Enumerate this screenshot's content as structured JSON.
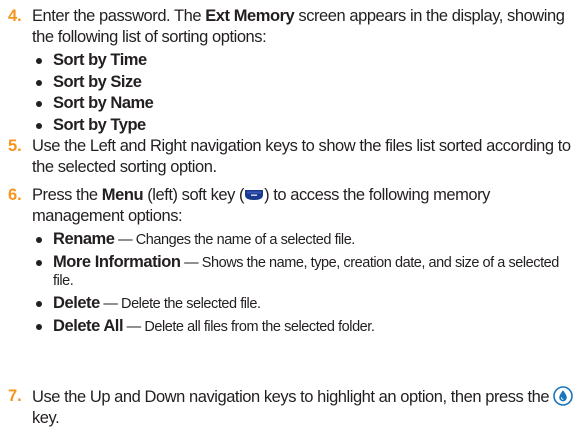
{
  "colors": {
    "step_number": "#f7941d",
    "text": "#231f20",
    "icon_blue": "#1b75bb",
    "softkey_fill": "#1a3a8f"
  },
  "step4": {
    "number": "4.",
    "text_before": "Enter the password. The ",
    "screen_name": "Ext Memory",
    "text_after": " screen appears in the display, showing the following list of sorting options:",
    "options": [
      "Sort by Time",
      "Sort by Size",
      "Sort by Name",
      "Sort by Type"
    ]
  },
  "step5": {
    "number": "5.",
    "text": "Use the Left and Right navigation keys to show the files list sorted according to the selected sorting option."
  },
  "step6": {
    "number": "6.",
    "text_before": "Press the ",
    "menu_label": "Menu",
    "text_middle": " (left) soft key (",
    "softkey_icon": "left-softkey-icon",
    "text_after": ") to access the following memory management options:",
    "options": [
      {
        "term": "Rename",
        "desc": "Changes the name of a selected file."
      },
      {
        "term": "More Information",
        "desc": "Shows the name, type, creation date, and size of a selected file."
      },
      {
        "term": "Delete",
        "desc": "Delete the selected file."
      },
      {
        "term": "Delete All",
        "desc": "Delete all files from the selected folder."
      }
    ],
    "dash": " — "
  },
  "step7": {
    "number": "7.",
    "text_before": "Use the Up and Down navigation keys to highlight an option, then press the ",
    "ok_icon": "ok-key-icon",
    "text_after": "key."
  }
}
